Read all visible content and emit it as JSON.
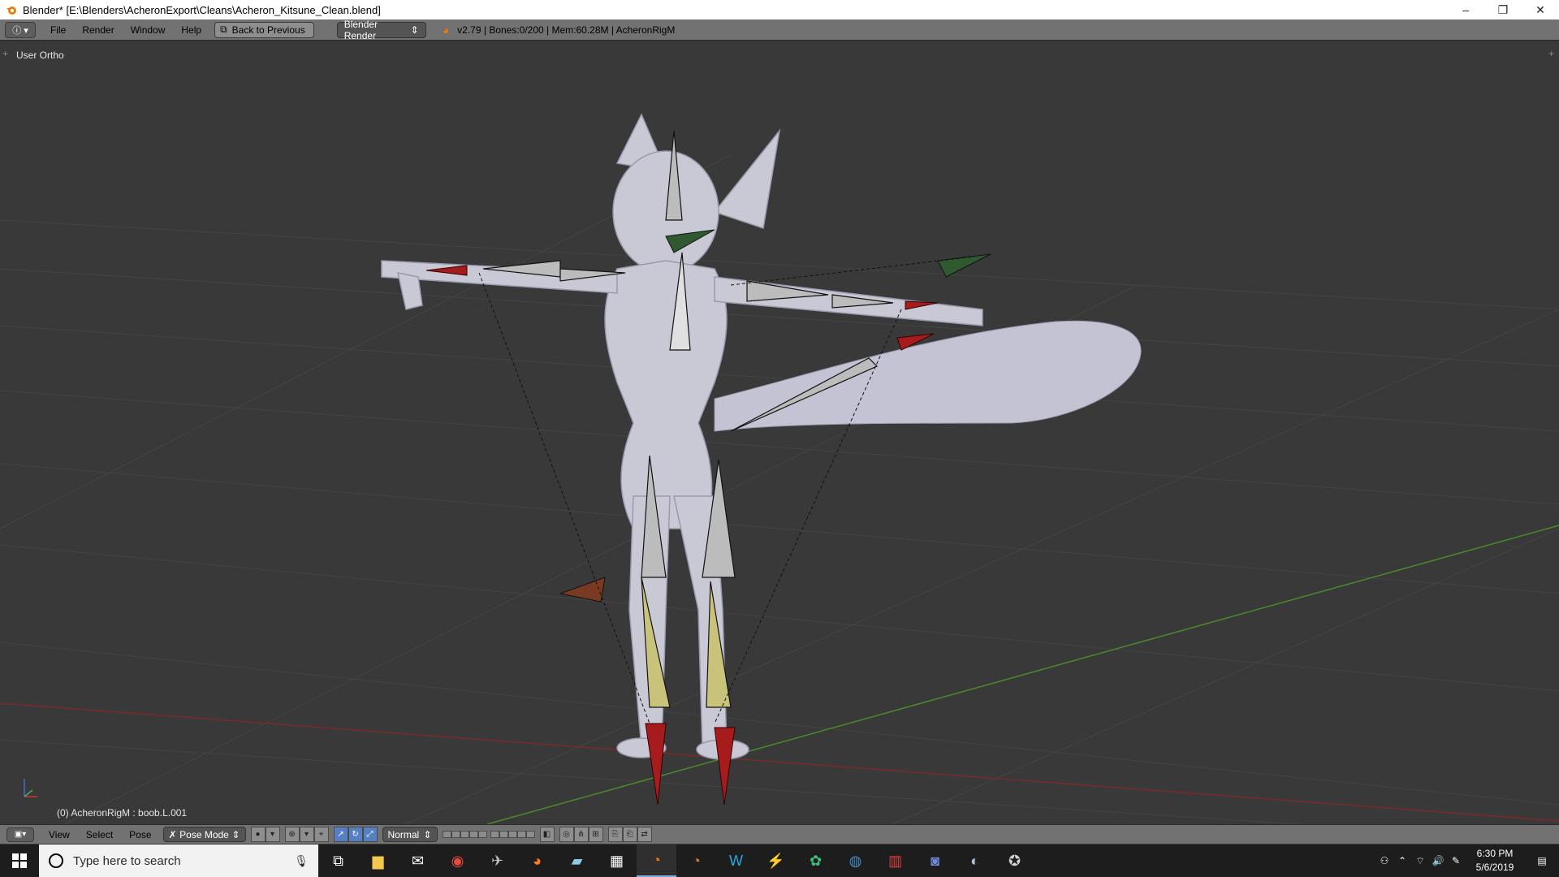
{
  "window": {
    "title": "Blender* [E:\\Blenders\\AcheronExport\\Cleans\\Acheron_Kitsune_Clean.blend]",
    "minimize": "–",
    "restore": "❐",
    "close": "✕"
  },
  "info_header": {
    "editor_icon": "ⓘ ▾",
    "menus": [
      "File",
      "Render",
      "Window",
      "Help"
    ],
    "back_button": "Back to Previous",
    "render_engine": "Blender Render",
    "stats": "v2.79 | Bones:0/200 | Mem:60.28M | AcheronRigM"
  },
  "viewport": {
    "view_label": "User Ortho",
    "object_info": "(0) AcheronRigM : boob.L.001"
  },
  "view_header": {
    "menus": [
      "View",
      "Select",
      "Pose"
    ],
    "mode": "Pose Mode",
    "orientation": "Normal"
  },
  "taskbar": {
    "search_placeholder": "Type here to search",
    "time": "6:30 PM",
    "date": "5/6/2019",
    "apps": [
      {
        "name": "task-view-icon",
        "glyph": "⧉",
        "color": "#ffffff"
      },
      {
        "name": "file-explorer-icon",
        "glyph": "▆",
        "color": "#f2c94c"
      },
      {
        "name": "mail-icon",
        "glyph": "✉",
        "color": "#ffffff"
      },
      {
        "name": "chrome-icon",
        "glyph": "◉",
        "color": "#e84b3c"
      },
      {
        "name": "game-icon",
        "glyph": "✈",
        "color": "#bfbfbf"
      },
      {
        "name": "firefox-icon",
        "glyph": "◕",
        "color": "#ff7a18"
      },
      {
        "name": "notes-icon",
        "glyph": "▰",
        "color": "#8ec9e8"
      },
      {
        "name": "calculator-icon",
        "glyph": "▦",
        "color": "#ffffff"
      },
      {
        "name": "blender-icon",
        "glyph": "◔",
        "color": "#e87d0d"
      },
      {
        "name": "blender-alt-icon",
        "glyph": "◔",
        "color": "#e87d0d"
      },
      {
        "name": "writer-icon",
        "glyph": "W",
        "color": "#2aa7e0"
      },
      {
        "name": "bolt-icon",
        "glyph": "⚡",
        "color": "#f5c542"
      },
      {
        "name": "green-app-icon",
        "glyph": "✿",
        "color": "#3fbf7f"
      },
      {
        "name": "godot-icon",
        "glyph": "◍",
        "color": "#478cbf"
      },
      {
        "name": "piano-icon",
        "glyph": "▥",
        "color": "#e04040"
      },
      {
        "name": "discord-icon",
        "glyph": "◙",
        "color": "#7289da"
      },
      {
        "name": "steam-icon",
        "glyph": "◐",
        "color": "#a8c4e0"
      },
      {
        "name": "star-app-icon",
        "glyph": "✪",
        "color": "#d0d0d0"
      }
    ]
  },
  "colors": {
    "viewport_bg": "#393939",
    "header_bg": "#727272",
    "mesh": "#c9c9d6",
    "bone_selected_red": "#a61c1c",
    "bone_yellow": "#c8c27a",
    "bone_green": "#2f5a2f",
    "x_axis": "#7a2a2a",
    "y_axis": "#4b8a2a"
  }
}
